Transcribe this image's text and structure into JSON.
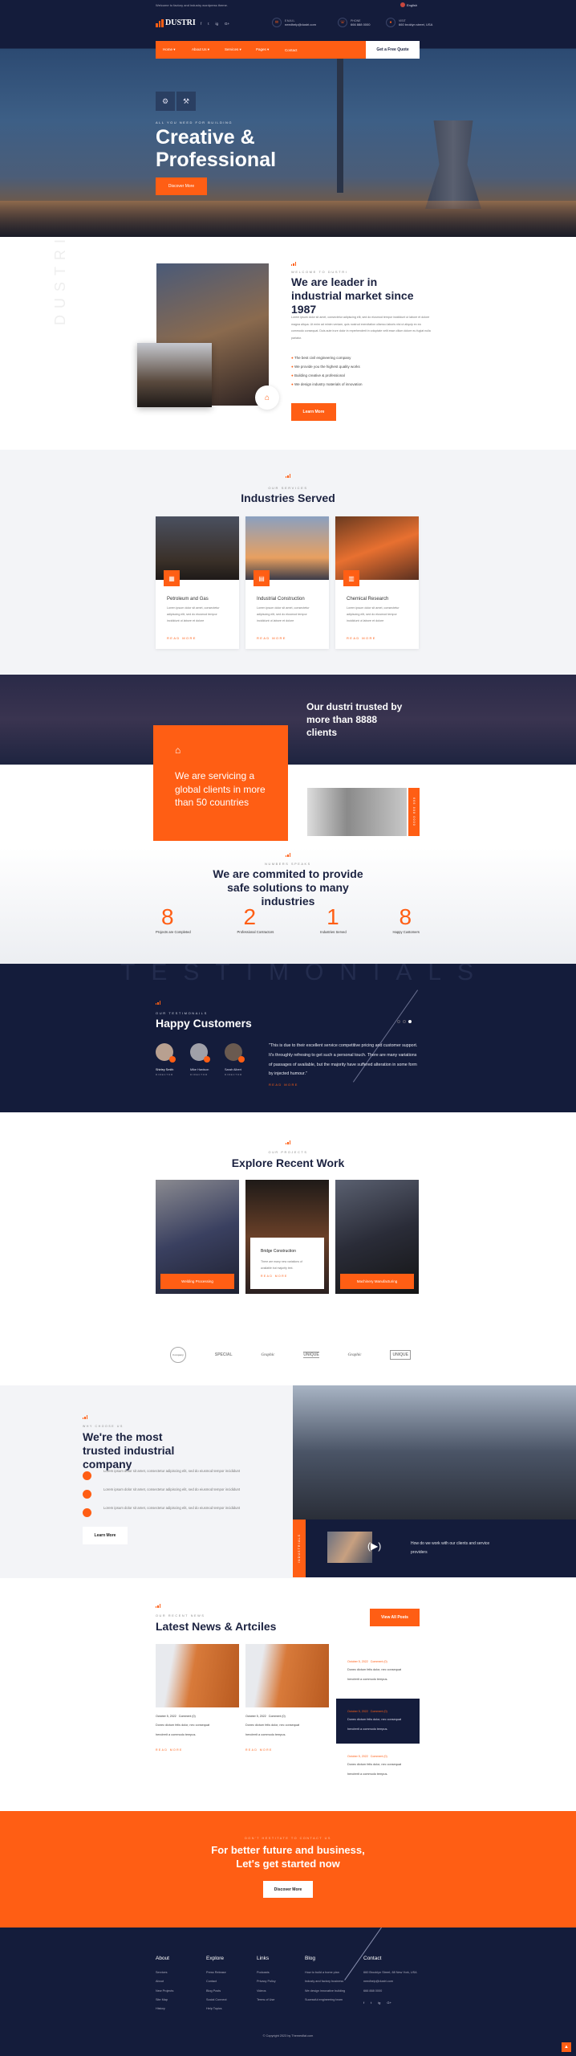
{
  "colors": {
    "accent": "#ff5e14",
    "navy": "#141c3b",
    "light": "#f3f4f7"
  },
  "topbar": {
    "welcome": "Welcome to factory and industry wordpress theme.",
    "language": "English"
  },
  "header": {
    "logo": "DUSTRI",
    "logo_tagline": "FACTORY & INDUSTRY",
    "social": [
      "f",
      "t",
      "ig",
      "G+"
    ],
    "contacts": [
      {
        "icon": "envelope-icon",
        "label": "EMAIL",
        "value": "needhelp@dustri.com"
      },
      {
        "icon": "phone-icon",
        "label": "PHONE",
        "value": "666 888 0000"
      },
      {
        "icon": "location-icon",
        "label": "VISIT",
        "value": "660 broklyn street, USA"
      }
    ]
  },
  "nav": {
    "items": [
      "Home",
      "About Us",
      "Services",
      "Pages",
      "Contact"
    ],
    "cta": "Get a Free Quote"
  },
  "hero": {
    "tagline": "ALL YOU NEED FOR BUILDING",
    "title_line1": "Creative &",
    "title_line2": "Professional",
    "button": "Discover More"
  },
  "about": {
    "watermark": "DUSTRI",
    "subtitle": "WELCOME TO DUSTRI",
    "title": "We are leader in industrial market since 1987",
    "text": "Lorem ipsum dolor sit amet, consectetur adipiscing elit, sed do eiusmod tempor incididunt ut labore et dolore magna aliqua. Ut enim ad minim veniam, quis nostrud exercitation ullamco laboris nisi ut aliquip ex ea commodo consequat. Duis aute irure dolor in reprehenderit in voluptate velit esse cillum dolore eu fugiat nulla pariatur.",
    "list": [
      "The best civil engineering company",
      "We provide you the highest quality works",
      "Building creative & professional",
      "We design industry materials of innovation"
    ],
    "button": "Learn More"
  },
  "services": {
    "subtitle": "OUR SERVICES",
    "title": "Industries Served",
    "cards": [
      {
        "title": "Petroleum and Gas",
        "text": "Lorem ipsum dolor sit amet, consectetur adipiscing elit, sed do eiusmod tempor incididunt ut labore et dolore",
        "link": "READ MORE"
      },
      {
        "title": "Industrial Construction",
        "text": "Lorem ipsum dolor sit amet, consectetur adipiscing elit, sed do eiusmod tempor incididunt ut labore et dolore",
        "link": "READ MORE"
      },
      {
        "title": "Chemical Research",
        "text": "Lorem ipsum dolor sit amet, consectetur adipiscing elit, sed do eiusmod tempor incididunt ut labore et dolore",
        "link": "READ MORE"
      }
    ]
  },
  "trusted": {
    "title": "Our dustri trusted by more than 8888 clients",
    "box_text": "We are servicing a global clients in more than 50 countries",
    "phone_vertical": "666 888 0000"
  },
  "numbers": {
    "subtitle": "NUMBERS SPEAKS",
    "title": "We are commited to provide safe solutions to many industries",
    "stats": [
      {
        "value": "8",
        "label": "Projects are Completed"
      },
      {
        "value": "2",
        "label": "Professional Contractors"
      },
      {
        "value": "1",
        "label": "Industries Served"
      },
      {
        "value": "8",
        "label": "Happy Customers"
      }
    ]
  },
  "testimonials": {
    "watermark": "TESTIMONIALS",
    "subtitle": "OUR TESTIMONAILS",
    "title": "Happy Customers",
    "people": [
      {
        "name": "Shirley Smith",
        "role": "DIRECTOR"
      },
      {
        "name": "Mike Hardson",
        "role": "DIRECTOR"
      },
      {
        "name": "Sarah Albert",
        "role": "DIRECTOR"
      }
    ],
    "quote": "\"This is due to their excellent service competitive pricing and customer support. It's throughly refresing to get such a personal touch. There are many variations of passages of available, but the majority have suffered alteration in some form by injected humour.\"",
    "link": "READ MORE",
    "active_dot": 3
  },
  "projects": {
    "subtitle": "OUR PROJECTS",
    "title": "Explore Recent Work",
    "items": [
      {
        "title": "Welding Processing"
      },
      {
        "title": "Bridge Construction",
        "text": "There are many new variations of available but majority text.",
        "link": "READ MORE"
      },
      {
        "title": "Machinery Manufacturing"
      }
    ]
  },
  "logos": [
    "Company",
    "SPECIAL",
    "Graphic",
    "UNIQUE",
    "Graphic",
    "UNIQUE"
  ],
  "why": {
    "subtitle": "WHY CHOOSE US",
    "title": "We're the most trusted industrial company",
    "items": [
      "Lorem ipsum dolor sit amet, consectetur adipiscing elit, sed do eiusmod tempor incididunt",
      "Lorem ipsum dolor sit amet, consectetur adipiscing elit, sed do eiusmod tempor incididunt",
      "Lorem ipsum dolor sit amet, consectetur adipiscing elit, sed do eiusmod tempor incididunt"
    ],
    "button": "Learn More",
    "vertical": "INDUSTRIALS",
    "video_text": "How do we work with our clients and service providers"
  },
  "news": {
    "subtitle": "OUR RECENT NEWS",
    "title": "Latest News & Artciles",
    "button": "View All Posts",
    "posts": [
      {
        "date": "October 5, 2022",
        "comments": "Comment (0)",
        "text": "Donec dictum felis dolor, nec consequat hendrerit a commodo tempus.",
        "link": "READ MORE"
      },
      {
        "date": "October 5, 2022",
        "comments": "Comment (0)",
        "text": "Donec dictum felis dolor, nec consequat hendrerit a commodo tempus.",
        "link": "READ MORE"
      }
    ],
    "side": [
      {
        "date": "October 5, 2022",
        "comments": "Comment (0)",
        "text": "Donec dictum felis dolor, nec consequat hendrerit a commodo tempus."
      },
      {
        "date": "October 5, 2022",
        "comments": "Comment (0)",
        "text": "Donec dictum felis dolor, nec consequat hendrerit a commodo tempus."
      },
      {
        "date": "October 5, 2022",
        "comments": "Comment (0)",
        "text": "Donec dictum felis dolor, nec consequat hendrerit a commodo tempus."
      }
    ]
  },
  "cta": {
    "subtitle": "DON'T HESTITATE TO CONTACT US",
    "title_line1": "For better future and business,",
    "title_line2": "Let's get started now",
    "button": "Discover More"
  },
  "footer": {
    "columns": [
      {
        "title": "About",
        "links": [
          "Services",
          "About",
          "New Projects",
          "Site Map",
          "History"
        ]
      },
      {
        "title": "Explore",
        "links": [
          "Press Release",
          "Contact",
          "Blog Posts",
          "Social Connect",
          "Help Topics"
        ]
      },
      {
        "title": "Links",
        "links": [
          "Podcasts",
          "Privacy Policy",
          "Videos",
          "Terms of Use"
        ]
      },
      {
        "title": "Blog",
        "links": [
          "How to build a home plan",
          "Industy and factory business",
          "We design innovative building",
          "Sucessful engineering team"
        ]
      },
      {
        "title": "Contact",
        "links": [
          "660 Brooklyn Street, 88 New York, USA",
          "needhelp@dustri.com",
          "666 888 0000"
        ]
      }
    ],
    "social": [
      "f",
      "t",
      "ig",
      "G+"
    ],
    "copyright": "© Copyright 2023 by Themesflat.com"
  }
}
